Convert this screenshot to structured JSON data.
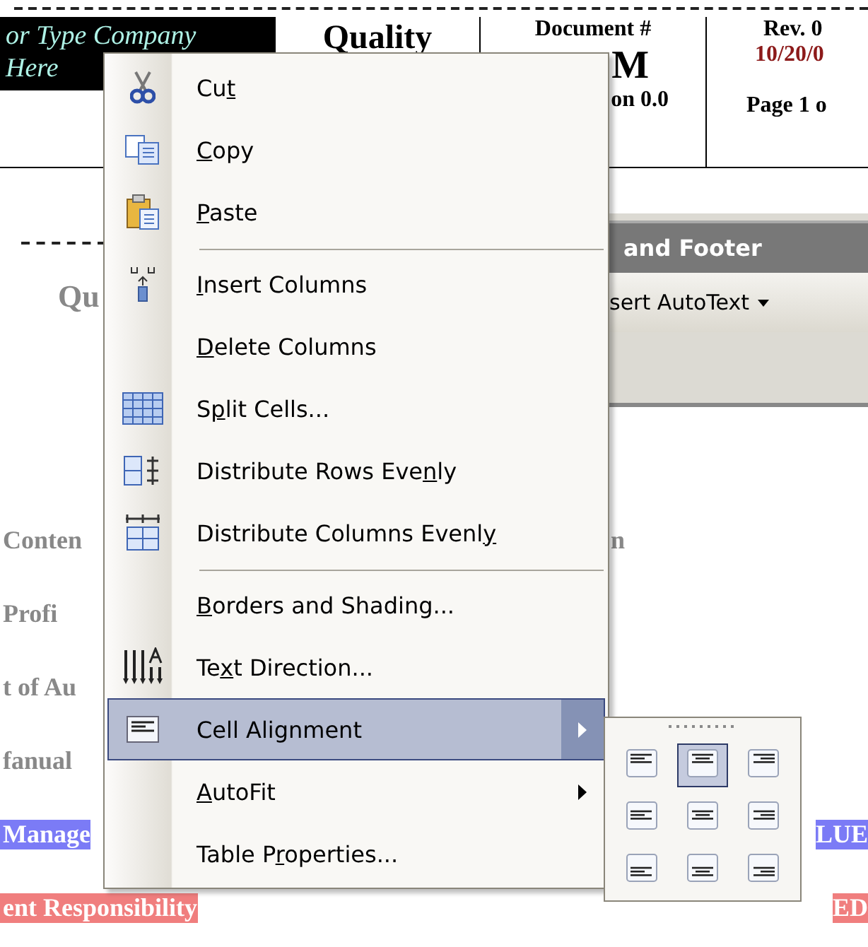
{
  "document": {
    "header_table": {
      "company": [
        "or Type Company",
        "Here"
      ],
      "title": "Quality",
      "doc_label": "Document #",
      "doc_code": "M",
      "doc_version": "on 0.0",
      "rev": "Rev. 0",
      "date": "10/20/0",
      "page": "Page 1 o"
    },
    "heading": "Qu",
    "lines": [
      {
        "left": "Conten",
        "right": "n"
      },
      {
        "left": "Profi"
      },
      {
        "left": "t of Au"
      },
      {
        "left": "fanual"
      },
      {
        "left": "Manage",
        "right": "LUE",
        "color": "#7b7bf6"
      },
      {
        "left": "ent Responsibility",
        "right": "ED",
        "color": "#f07e7e"
      }
    ]
  },
  "toolbar": {
    "title": "and Footer",
    "button": "sert AutoText"
  },
  "context_menu": {
    "items": [
      {
        "pre": "Cu",
        "key": "t",
        "separator_before": false,
        "submenu": false,
        "selected": false
      },
      {
        "key": "C",
        "post": "opy",
        "separator_before": false,
        "submenu": false,
        "selected": false
      },
      {
        "key": "P",
        "post": "aste",
        "separator_before": false,
        "submenu": false,
        "selected": false
      },
      {
        "key": "I",
        "post": "nsert Columns",
        "separator_before": true,
        "submenu": false,
        "selected": false
      },
      {
        "key": "D",
        "post": "elete Columns",
        "separator_before": false,
        "submenu": false,
        "selected": false
      },
      {
        "pre": "S",
        "key": "p",
        "post": "lit Cells...",
        "separator_before": false,
        "submenu": false,
        "selected": false
      },
      {
        "pre": "Distribute Rows Eve",
        "key": "n",
        "post": "ly",
        "separator_before": false,
        "submenu": false,
        "selected": false
      },
      {
        "pre": "Distribute Columns Evenl",
        "key": "y",
        "separator_before": false,
        "submenu": false,
        "selected": false
      },
      {
        "key": "B",
        "post": "orders and Shading...",
        "separator_before": true,
        "submenu": false,
        "selected": false
      },
      {
        "pre": "Te",
        "key": "x",
        "post": "t Direction...",
        "separator_before": false,
        "submenu": false,
        "selected": false
      },
      {
        "pre": "Cell Alignment",
        "separator_before": false,
        "submenu": true,
        "selected": true
      },
      {
        "key": "A",
        "post": "utoFit",
        "separator_before": false,
        "submenu": true,
        "selected": false
      },
      {
        "pre": "Table P",
        "key": "r",
        "post": "operties...",
        "separator_before": false,
        "submenu": false,
        "selected": false
      }
    ]
  },
  "alignment_palette": {
    "buttons": [
      {
        "selected": false
      },
      {
        "selected": true
      },
      {
        "selected": false
      },
      {
        "selected": false
      },
      {
        "selected": false
      },
      {
        "selected": false
      },
      {
        "selected": false
      },
      {
        "selected": false
      },
      {
        "selected": false
      }
    ]
  }
}
